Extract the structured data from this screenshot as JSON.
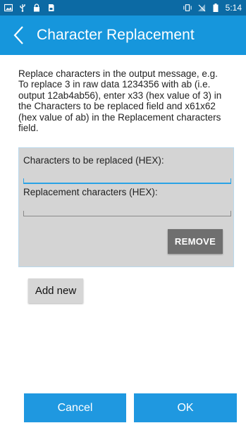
{
  "status_bar": {
    "time": "5:14",
    "icons_left": [
      "image-icon",
      "usb-icon",
      "lock-icon",
      "sd-card-icon"
    ],
    "icons_right": [
      "vibrate-icon",
      "no-signal-icon",
      "battery-icon"
    ]
  },
  "app_bar": {
    "title": "Character Replacement",
    "back_icon": "back-chevron-icon",
    "color": "#1696dc"
  },
  "description": "   Replace characters in the output message, e.g.\nTo replace 3 in raw data 1234356 with ab (i.e.\noutput 12ab4ab56), enter x33 (hex value of 3) in\nthe Characters to be replaced field and x61x62\n(hex value of ab) in the Replacement characters\nfield.",
  "panel": {
    "replaced_label": "Characters to be replaced (HEX):",
    "replaced_value": "",
    "replacement_label": "Replacement characters (HEX):",
    "replacement_value": "",
    "remove_label": "REMOVE"
  },
  "add_new_label": "Add new",
  "footer": {
    "cancel_label": "Cancel",
    "ok_label": "OK"
  }
}
